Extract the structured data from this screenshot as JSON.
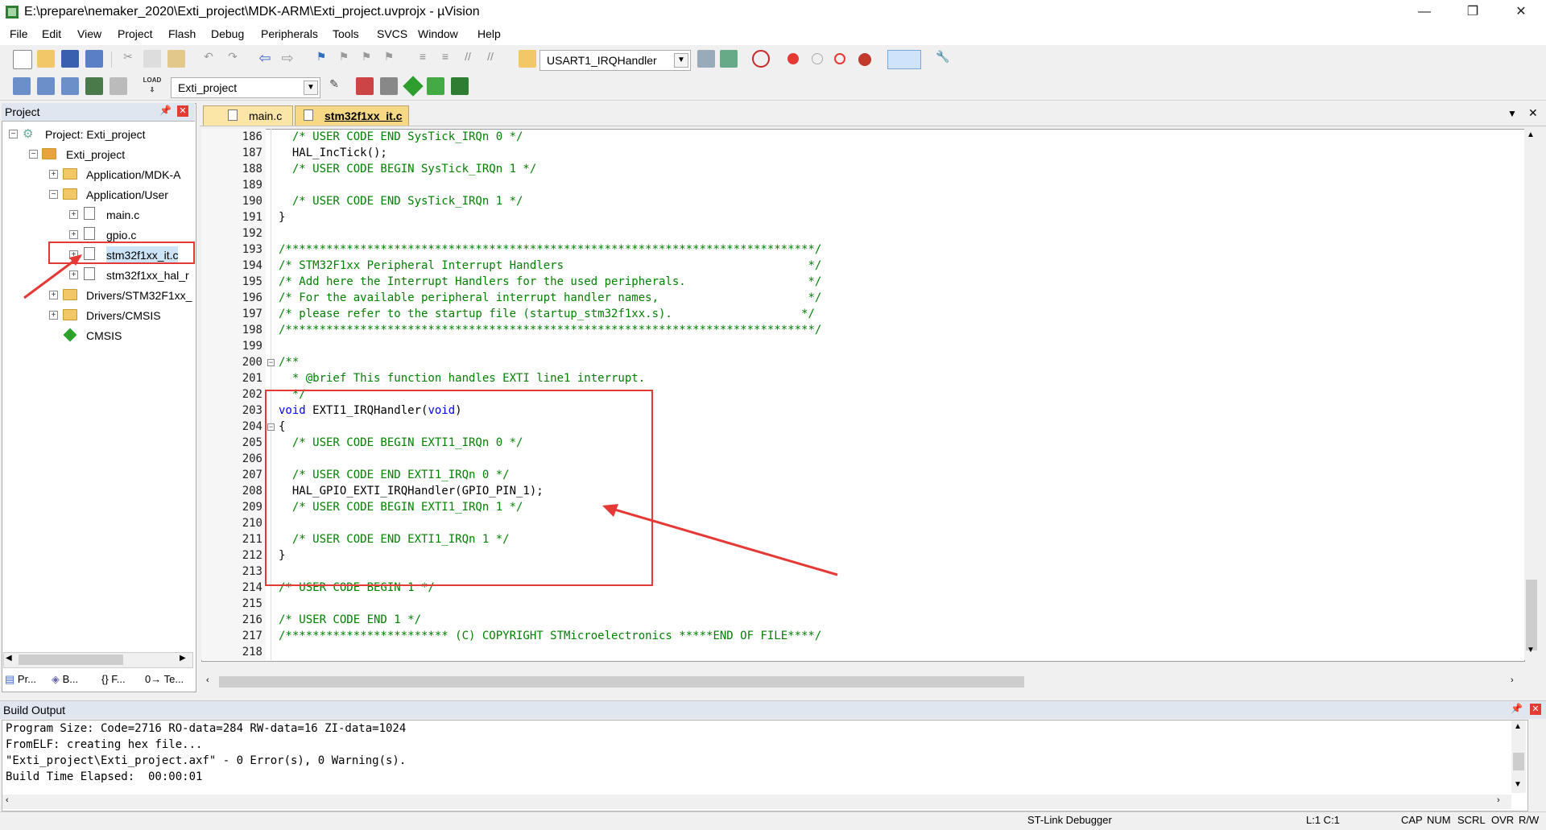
{
  "window": {
    "title": "E:\\prepare\\nemaker_2020\\Exti_project\\MDK-ARM\\Exti_project.uvprojx - µVision",
    "minimize": "—",
    "maximize": "❐",
    "close": "✕"
  },
  "menu": [
    "File",
    "Edit",
    "View",
    "Project",
    "Flash",
    "Debug",
    "Peripherals",
    "Tools",
    "SVCS",
    "Window",
    "Help"
  ],
  "toolbar": {
    "function_combo": "USART1_IRQHandler",
    "target_combo": "Exti_project",
    "load_label": "LOAD"
  },
  "project_panel": {
    "title": "Project",
    "tree": [
      {
        "label": "Project: Exti_project"
      },
      {
        "label": "Exti_project"
      },
      {
        "label": "Application/MDK-A"
      },
      {
        "label": "Application/User"
      },
      {
        "label": "main.c"
      },
      {
        "label": "gpio.c"
      },
      {
        "label": "stm32f1xx_it.c"
      },
      {
        "label": "stm32f1xx_hal_r"
      },
      {
        "label": "Drivers/STM32F1xx_"
      },
      {
        "label": "Drivers/CMSIS"
      },
      {
        "label": "CMSIS"
      }
    ],
    "bottom_tabs": [
      "Pr...",
      "B...",
      "{} F...",
      "0→ Te..."
    ]
  },
  "editor": {
    "tabs": [
      "main.c",
      "stm32f1xx_it.c"
    ],
    "active_tab": "stm32f1xx_it.c",
    "lines": [
      {
        "n": "186",
        "text": "  /* USER CODE END SysTick_IRQn 0 */"
      },
      {
        "n": "187",
        "text": "  HAL_IncTick();"
      },
      {
        "n": "188",
        "text": "  /* USER CODE BEGIN SysTick_IRQn 1 */"
      },
      {
        "n": "189",
        "text": ""
      },
      {
        "n": "190",
        "text": "  /* USER CODE END SysTick_IRQn 1 */"
      },
      {
        "n": "191",
        "text": "}"
      },
      {
        "n": "192",
        "text": ""
      },
      {
        "n": "193",
        "text": "/******************************************************************************/"
      },
      {
        "n": "194",
        "text": "/* STM32F1xx Peripheral Interrupt Handlers                                    */"
      },
      {
        "n": "195",
        "text": "/* Add here the Interrupt Handlers for the used peripherals.                  */"
      },
      {
        "n": "196",
        "text": "/* For the available peripheral interrupt handler names,                      */"
      },
      {
        "n": "197",
        "text": "/* please refer to the startup file (startup_stm32f1xx.s).                   */"
      },
      {
        "n": "198",
        "text": "/******************************************************************************/"
      },
      {
        "n": "199",
        "text": ""
      },
      {
        "n": "200",
        "text": "/**"
      },
      {
        "n": "201",
        "text": "  * @brief This function handles EXTI line1 interrupt."
      },
      {
        "n": "202",
        "text": "  */"
      },
      {
        "n": "203",
        "text": "void EXTI1_IRQHandler(void)"
      },
      {
        "n": "204",
        "text": "{"
      },
      {
        "n": "205",
        "text": "  /* USER CODE BEGIN EXTI1_IRQn 0 */"
      },
      {
        "n": "206",
        "text": ""
      },
      {
        "n": "207",
        "text": "  /* USER CODE END EXTI1_IRQn 0 */"
      },
      {
        "n": "208",
        "text": "  HAL_GPIO_EXTI_IRQHandler(GPIO_PIN_1);"
      },
      {
        "n": "209",
        "text": "  /* USER CODE BEGIN EXTI1_IRQn 1 */"
      },
      {
        "n": "210",
        "text": ""
      },
      {
        "n": "211",
        "text": "  /* USER CODE END EXTI1_IRQn 1 */"
      },
      {
        "n": "212",
        "text": "}"
      },
      {
        "n": "213",
        "text": ""
      },
      {
        "n": "214",
        "text": "/* USER CODE BEGIN 1 */"
      },
      {
        "n": "215",
        "text": ""
      },
      {
        "n": "216",
        "text": "/* USER CODE END 1 */"
      },
      {
        "n": "217",
        "text": "/************************ (C) COPYRIGHT STMicroelectronics *****END OF FILE****/"
      },
      {
        "n": "218",
        "text": ""
      }
    ]
  },
  "build_output": {
    "title": "Build Output",
    "lines": [
      "Program Size: Code=2716 RO-data=284 RW-data=16 ZI-data=1024",
      "FromELF: creating hex file...",
      "\"Exti_project\\Exti_project.axf\" - 0 Error(s), 0 Warning(s).",
      "Build Time Elapsed:  00:00:01"
    ]
  },
  "status": {
    "debugger": "ST-Link Debugger",
    "cursor": "L:1 C:1",
    "indicators": [
      "CAP",
      "NUM",
      "SCRL",
      "OVR",
      "R/W"
    ]
  }
}
